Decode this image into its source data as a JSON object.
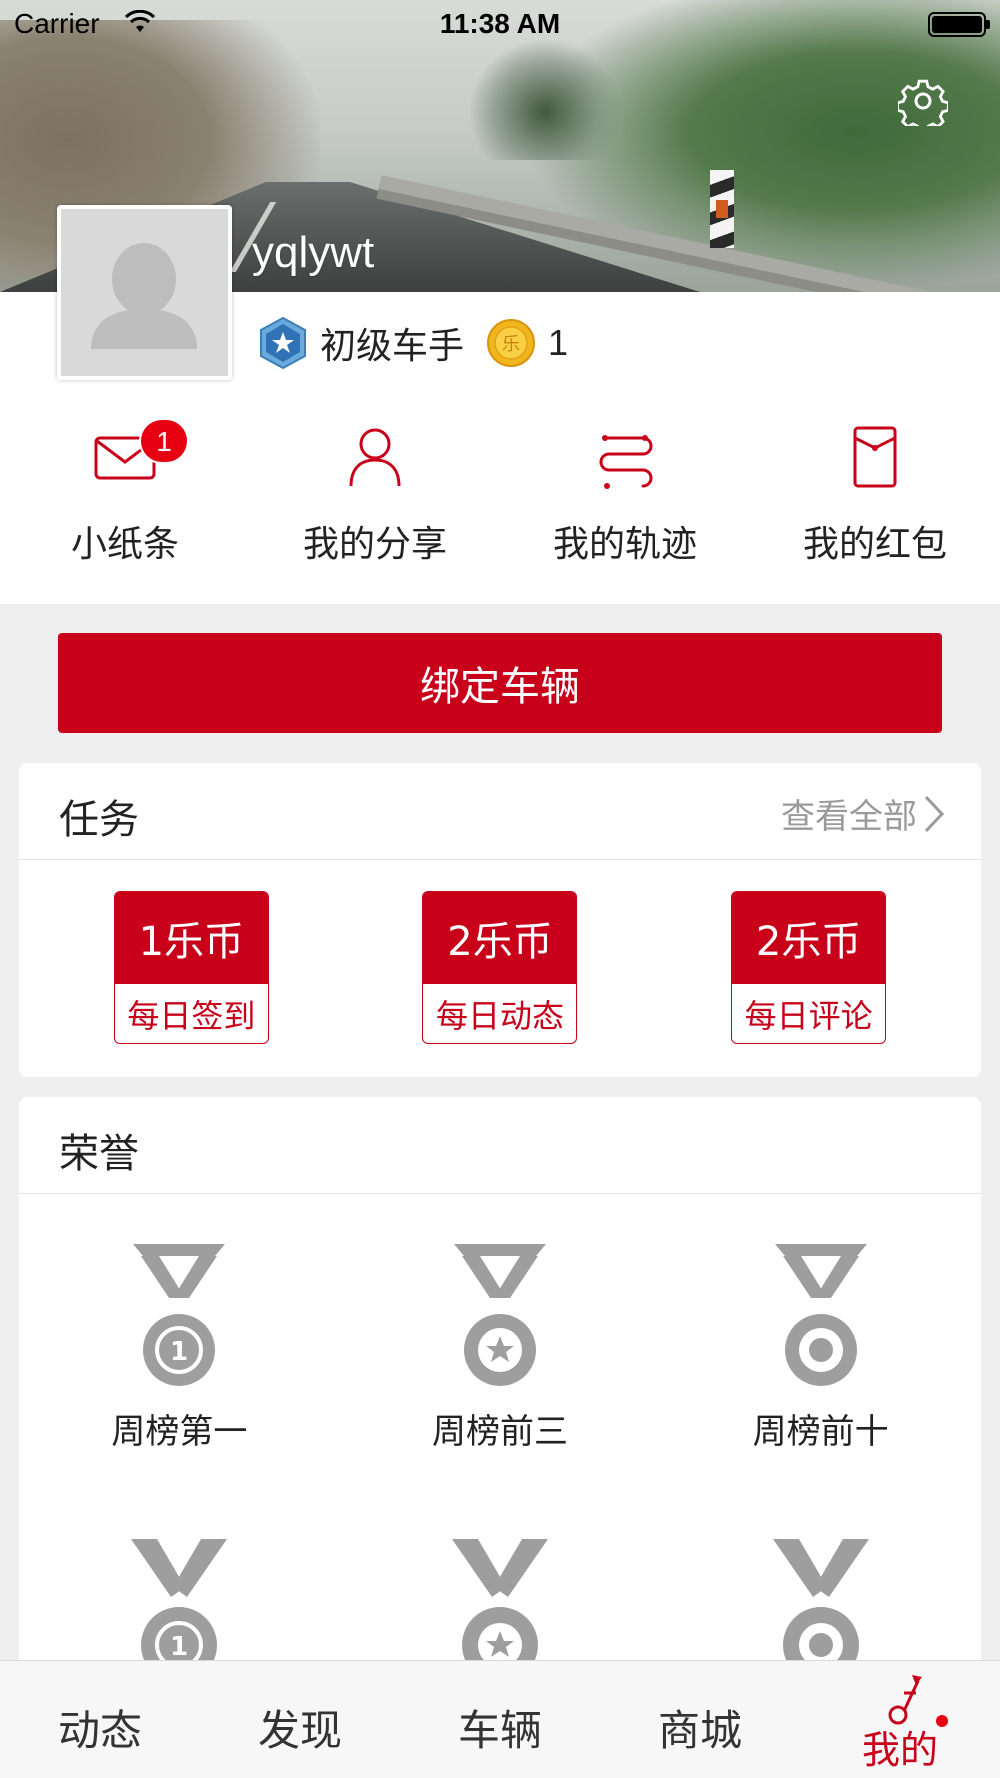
{
  "status_bar": {
    "carrier": "Carrier",
    "time": "11:38 AM"
  },
  "profile": {
    "username": "yqlywt",
    "level": "初级车手",
    "coins": "1"
  },
  "quick_actions": [
    {
      "label": "小纸条",
      "icon": "envelope-icon",
      "badge": "1"
    },
    {
      "label": "我的分享",
      "icon": "person-icon"
    },
    {
      "label": "我的轨迹",
      "icon": "track-icon"
    },
    {
      "label": "我的红包",
      "icon": "red-envelope-icon"
    }
  ],
  "bind_button": "绑定车辆",
  "tasks": {
    "title": "任务",
    "view_all": "查看全部",
    "items": [
      {
        "reward": "1乐币",
        "name": "每日签到"
      },
      {
        "reward": "2乐币",
        "name": "每日动态"
      },
      {
        "reward": "2乐币",
        "name": "每日评论"
      }
    ]
  },
  "honors": {
    "title": "荣誉",
    "items": [
      {
        "label": "周榜第一",
        "icon": "medal-first-icon"
      },
      {
        "label": "周榜前三",
        "icon": "medal-star-icon"
      },
      {
        "label": "周榜前十",
        "icon": "medal-ring-icon"
      },
      {
        "label": "",
        "icon": "medal-first-icon"
      },
      {
        "label": "",
        "icon": "medal-star-icon"
      },
      {
        "label": "",
        "icon": "medal-ring-icon"
      }
    ]
  },
  "tabbar": {
    "items": [
      {
        "label": "动态"
      },
      {
        "label": "发现"
      },
      {
        "label": "车辆"
      },
      {
        "label": "商城"
      },
      {
        "label": "我的",
        "active": true
      }
    ]
  },
  "colors": {
    "accent": "#c8001a",
    "badge": "#e60012"
  }
}
